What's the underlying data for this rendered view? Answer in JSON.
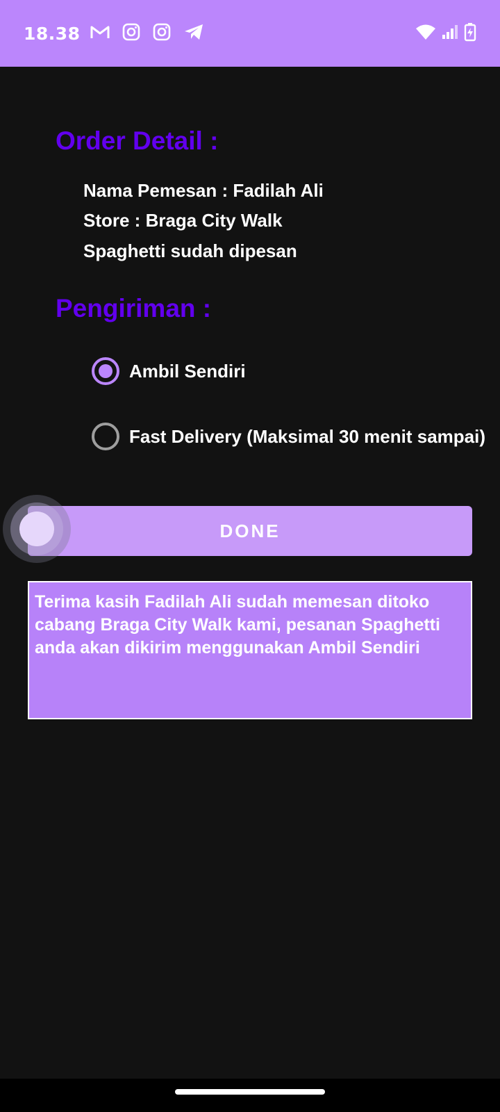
{
  "status_bar": {
    "time": "18.38",
    "left_icons": [
      "gmail-icon",
      "instagram-icon",
      "instagram-icon",
      "telegram-icon"
    ],
    "right_icons": [
      "wifi-icon",
      "signal-icon",
      "battery-charging-icon"
    ],
    "background": "#bb86fc"
  },
  "order_detail": {
    "title": "Order Detail :",
    "lines": [
      "Nama Pemesan : Fadilah Ali",
      "Store : Braga City Walk",
      "Spaghetti sudah dipesan"
    ]
  },
  "pengiriman": {
    "title": "Pengiriman :",
    "options": [
      {
        "label": "Ambil Sendiri",
        "selected": true
      },
      {
        "label": "Fast Delivery (Maksimal 30 menit sampai)",
        "selected": false
      }
    ]
  },
  "done_button": {
    "label": "DONE"
  },
  "result_message": "Terima kasih Fadilah Ali sudah memesan ditoko cabang Braga City Walk kami, pesanan Spaghetti anda akan dikirim menggunakan Ambil Sendiri",
  "colors": {
    "accent": "#6200ee",
    "primary_light": "#bb86fc",
    "button": "#c79af9",
    "result_box": "#b782f9",
    "background": "#121212"
  }
}
